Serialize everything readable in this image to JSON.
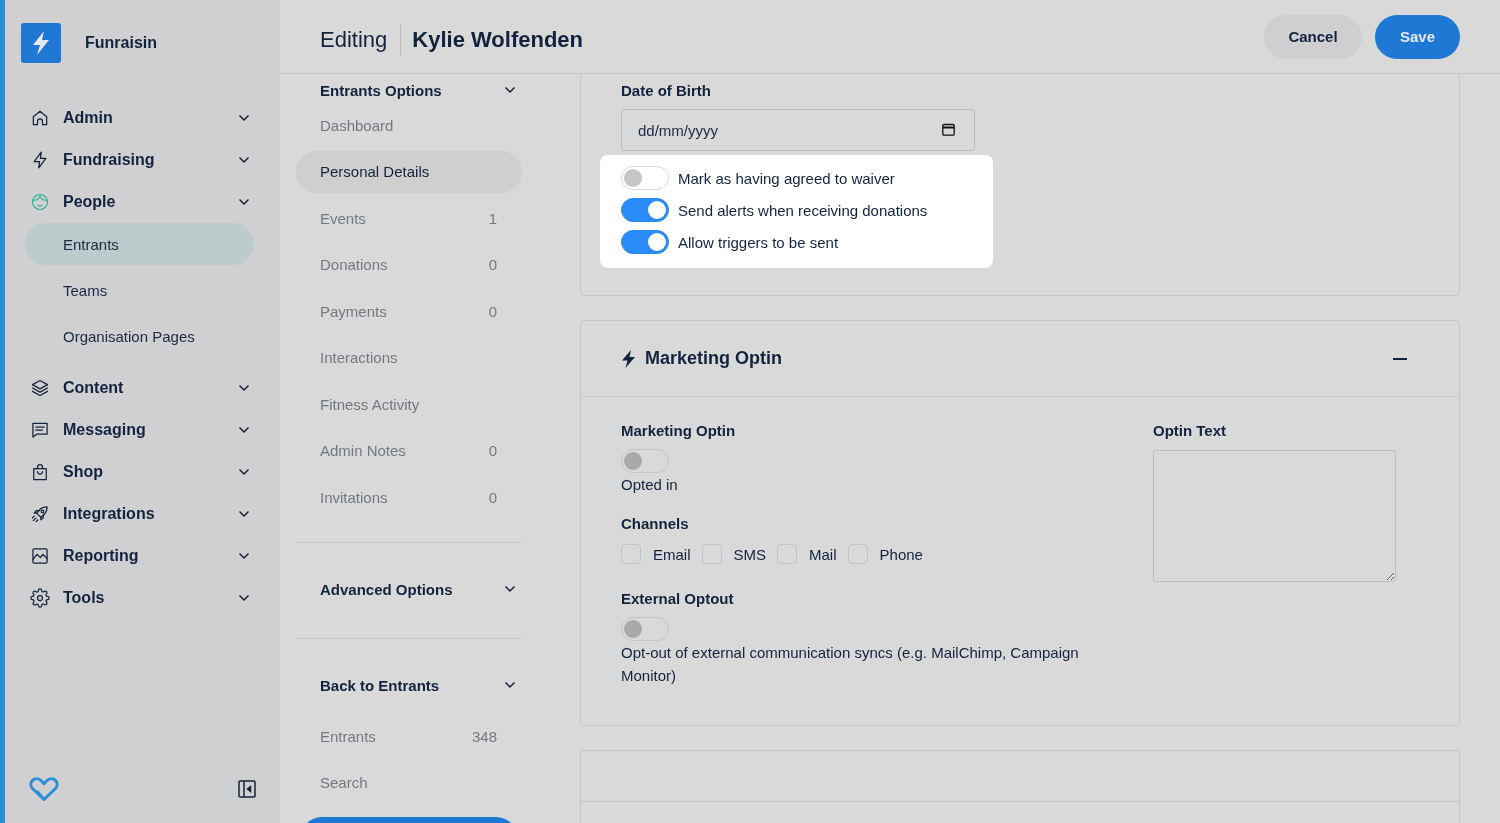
{
  "sidebar": {
    "brand": "Funraisin",
    "menu": [
      {
        "label": "Admin",
        "active": false
      },
      {
        "label": "Fundraising",
        "active": false
      },
      {
        "label": "People",
        "active": true,
        "children": [
          {
            "label": "Entrants",
            "selected": true
          },
          {
            "label": "Teams",
            "selected": false
          },
          {
            "label": "Organisation Pages",
            "selected": false
          }
        ]
      },
      {
        "label": "Content",
        "active": false
      },
      {
        "label": "Messaging",
        "active": false
      },
      {
        "label": "Shop",
        "active": false
      },
      {
        "label": "Integrations",
        "active": false
      },
      {
        "label": "Reporting",
        "active": false
      },
      {
        "label": "Tools",
        "active": false
      }
    ]
  },
  "header": {
    "mode": "Editing",
    "title": "Kylie Wolfenden",
    "buttons": [
      {
        "label": "Cancel",
        "kind": "secondary"
      },
      {
        "label": "Save",
        "kind": "primary"
      }
    ]
  },
  "section_nav": {
    "groups": [
      {
        "title": "Entrants Options",
        "items": [
          {
            "label": "Dashboard",
            "selected": false
          },
          {
            "label": "Personal Details",
            "selected": true
          },
          {
            "label": "Events",
            "count": "1",
            "selected": false
          },
          {
            "label": "Donations",
            "count": "0",
            "selected": false
          },
          {
            "label": "Payments",
            "count": "0",
            "selected": false
          },
          {
            "label": "Interactions",
            "selected": false
          },
          {
            "label": "Fitness Activity",
            "selected": false
          },
          {
            "label": "Admin Notes",
            "count": "0",
            "selected": false
          },
          {
            "label": "Invitations",
            "count": "0",
            "selected": false
          }
        ]
      },
      {
        "title": "Advanced Options"
      },
      {
        "title": "Back to Entrants",
        "items": [
          {
            "label": "Entrants",
            "count": "348",
            "selected": false
          },
          {
            "label": "Search",
            "selected": false
          }
        ]
      }
    ]
  },
  "details_card": {
    "date_field": {
      "label": "Date of Birth",
      "placeholder": "dd/mm/yyyy"
    },
    "toggles": [
      {
        "label": "Mark as having agreed to waiver",
        "on": false
      },
      {
        "label": "Send alerts when receiving donations",
        "on": true
      },
      {
        "label": "Allow triggers to be sent",
        "on": true
      }
    ]
  },
  "marketing_card": {
    "title": "Marketing Optin",
    "optin": {
      "label": "Marketing Optin",
      "on": false,
      "caption": "Opted in"
    },
    "channels": {
      "label": "Channels",
      "options": [
        {
          "label": "Email",
          "checked": false
        },
        {
          "label": "SMS",
          "checked": false
        },
        {
          "label": "Mail",
          "checked": false
        },
        {
          "label": "Phone",
          "checked": false
        }
      ]
    },
    "external_optout": {
      "label": "External Optout",
      "on": false,
      "caption": "Opt-out of external communication syncs (e.g. MailChimp, Campaign Monitor)"
    },
    "optin_text": {
      "label": "Optin Text"
    }
  }
}
